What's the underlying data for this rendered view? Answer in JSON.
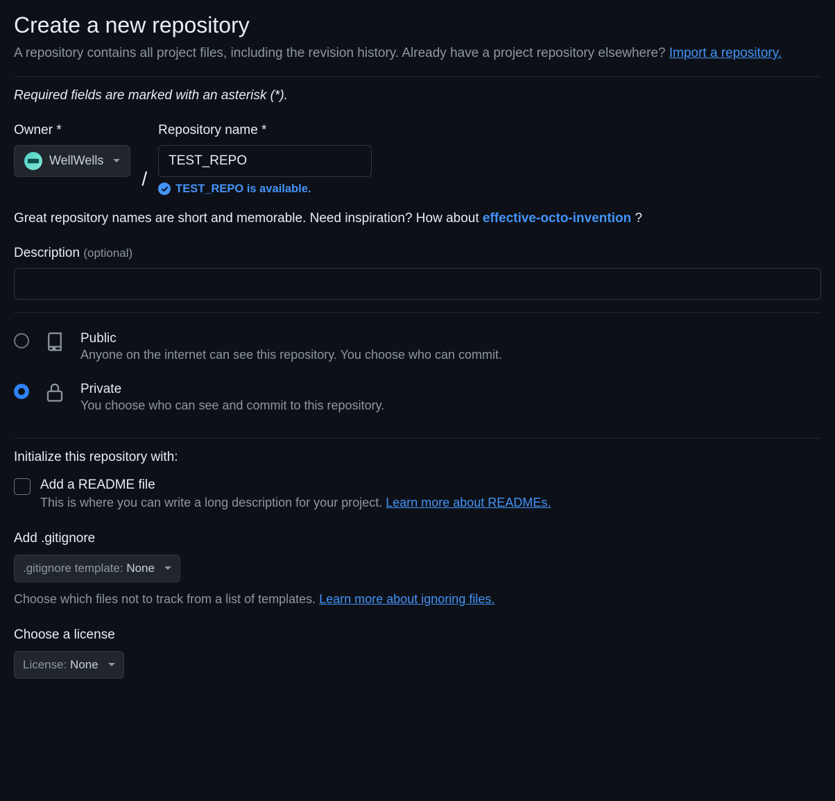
{
  "header": {
    "title": "Create a new repository",
    "subtitle_1": "A repository contains all project files, including the revision history. Already have a project repository elsewhere? ",
    "import_link": "Import a repository."
  },
  "required_note": "Required fields are marked with an asterisk (*).",
  "owner": {
    "label": "Owner *",
    "name": "WellWells"
  },
  "repo": {
    "label": "Repository name *",
    "value": "TEST_REPO",
    "available_text": "TEST_REPO is available."
  },
  "inspiration": {
    "prefix": "Great repository names are short and memorable. Need inspiration? How about ",
    "suggestion": "effective-octo-invention",
    "suffix": " ?"
  },
  "description": {
    "label": "Description",
    "optional": "(optional)",
    "value": ""
  },
  "visibility": {
    "public": {
      "title": "Public",
      "desc": "Anyone on the internet can see this repository. You choose who can commit."
    },
    "private": {
      "title": "Private",
      "desc": "You choose who can see and commit to this repository."
    },
    "selected": "private"
  },
  "init": {
    "heading": "Initialize this repository with:",
    "readme_title": "Add a README file",
    "readme_desc_prefix": "This is where you can write a long description for your project. ",
    "readme_link": "Learn more about READMEs."
  },
  "gitignore": {
    "label": "Add .gitignore",
    "button_prefix": ".gitignore template: ",
    "button_value": "None",
    "help_prefix": "Choose which files not to track from a list of templates. ",
    "help_link": "Learn more about ignoring files."
  },
  "license": {
    "label": "Choose a license",
    "button_prefix": "License: ",
    "button_value": "None"
  }
}
